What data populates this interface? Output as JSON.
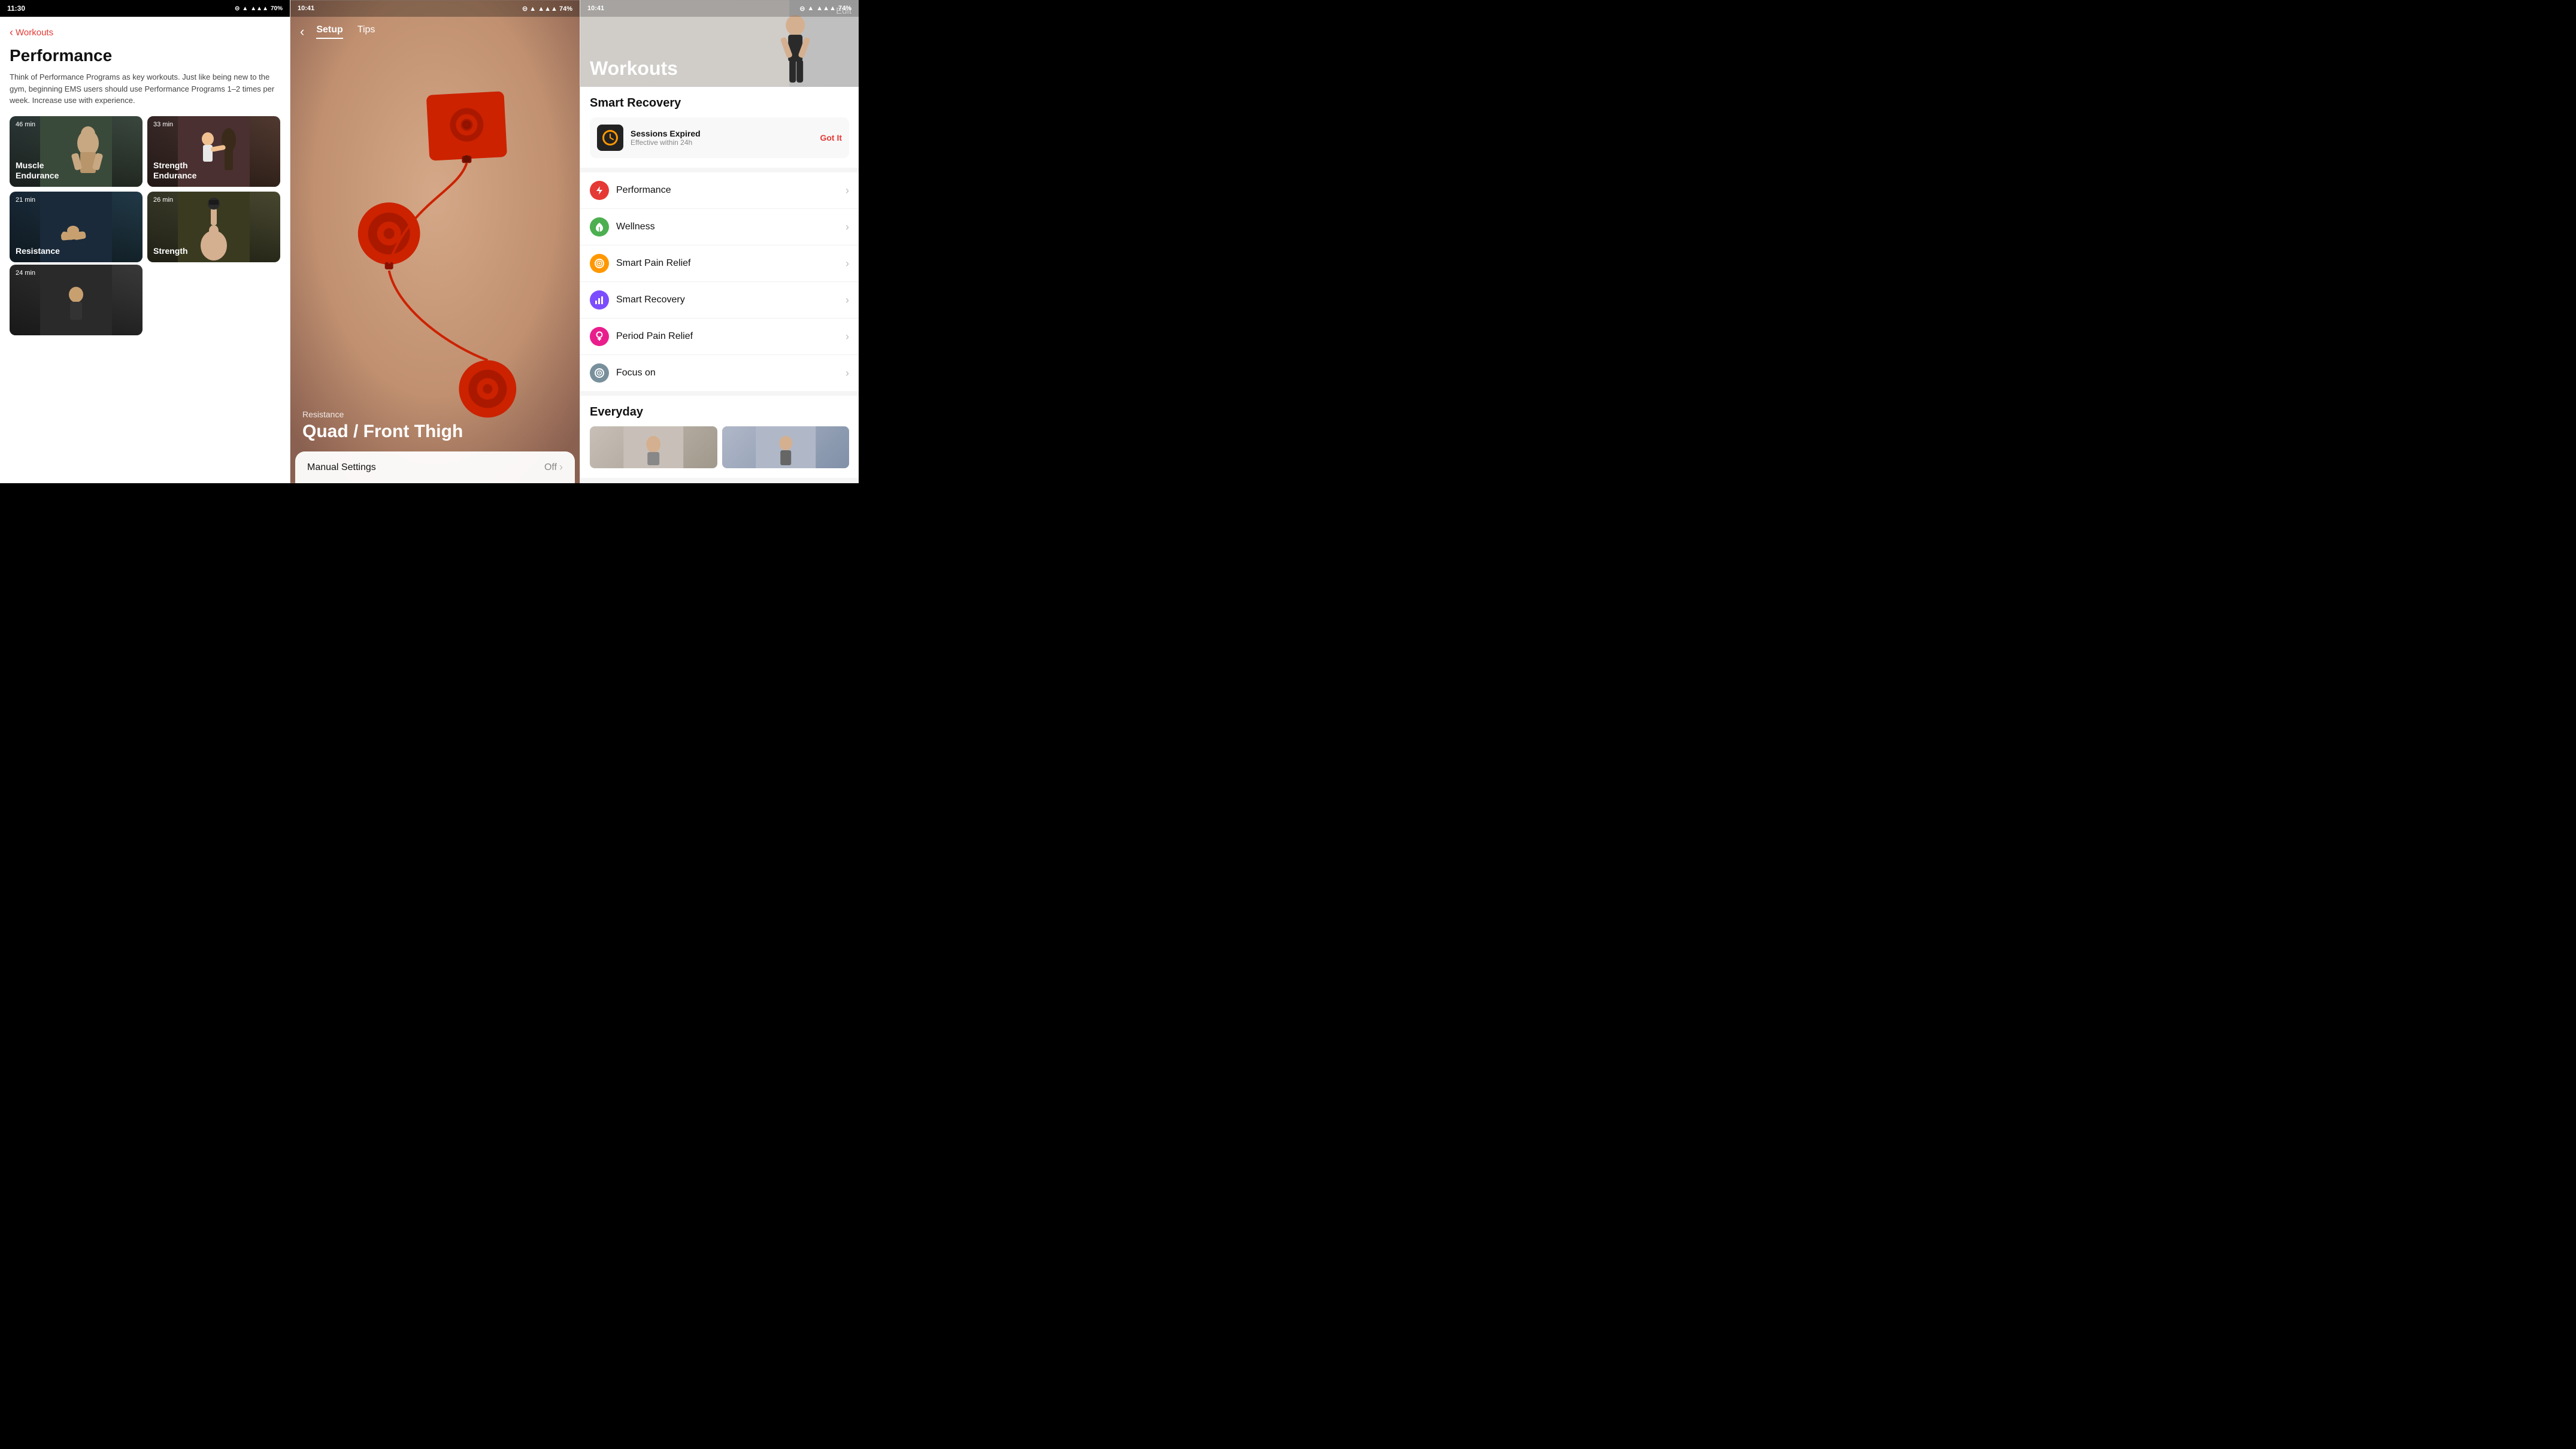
{
  "panel1": {
    "status": {
      "time": "11:30",
      "battery": "70%"
    },
    "back_label": "Workouts",
    "title": "Performance",
    "description": "Think of Performance Programs as key workouts. Just like being new to the gym, beginning EMS users should use Performance Programs 1–2 times per week. Increase use with experience.",
    "workouts": [
      {
        "time": "46 min",
        "label": "Muscle\nEndurance",
        "color": "card-muscle"
      },
      {
        "time": "33 min",
        "label": "Strength\nEndurance",
        "color": "card-strength-end"
      },
      {
        "time": "21 min",
        "label": "Resistance",
        "color": "card-resistance"
      },
      {
        "time": "26 min",
        "label": "Strength",
        "color": "card-strength"
      },
      {
        "time": "24 min",
        "label": "",
        "color": "card-last"
      }
    ]
  },
  "panel2": {
    "status": {
      "time": "10:41",
      "battery": "74%"
    },
    "tabs": [
      {
        "label": "Setup",
        "active": true
      },
      {
        "label": "Tips",
        "active": false
      }
    ],
    "location_label": "Resistance",
    "location_title": "Quad / Front Thigh",
    "manual_settings_label": "Manual Settings",
    "manual_settings_value": "Off"
  },
  "panel3": {
    "status": {
      "time": "10:41",
      "battery": "74%"
    },
    "header_title": "Workouts",
    "edit_label": "Edit",
    "smart_recovery": {
      "title": "Smart Recovery",
      "sessions_title": "Sessions Expired",
      "sessions_sub": "Effective within 24h",
      "got_it": "Got It"
    },
    "menu_items": [
      {
        "label": "Performance",
        "icon_color": "icon-red",
        "icon": "⚡"
      },
      {
        "label": "Wellness",
        "icon_color": "icon-green",
        "icon": "🌿"
      },
      {
        "label": "Smart Pain Relief",
        "icon_color": "icon-orange",
        "icon": "◎"
      },
      {
        "label": "Smart Recovery",
        "icon_color": "icon-purple",
        "icon": "📊"
      },
      {
        "label": "Period Pain Relief",
        "icon_color": "icon-pink",
        "icon": "♀"
      },
      {
        "label": "Focus on",
        "icon_color": "icon-gray",
        "icon": "⊙"
      }
    ],
    "everyday_title": "Everyday"
  }
}
